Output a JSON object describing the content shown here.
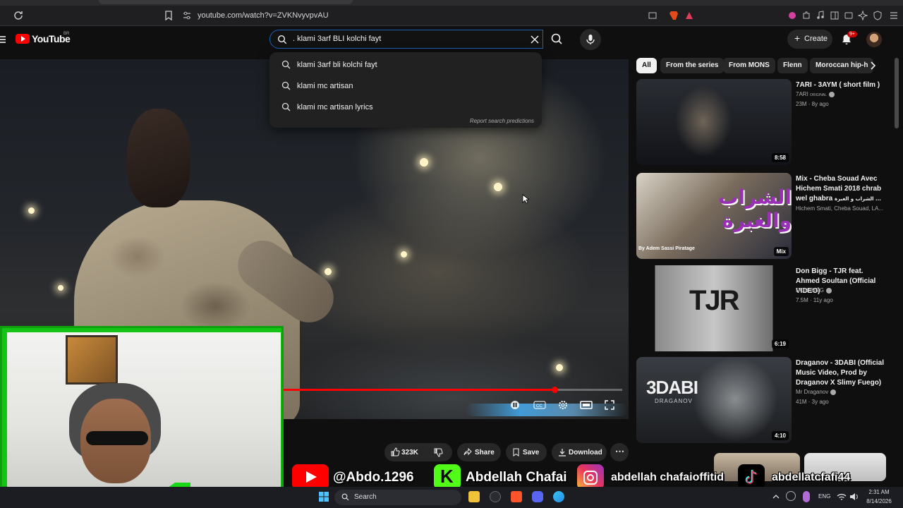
{
  "browser": {
    "url": "youtube.com/watch?v=ZVKNvyvpvAU"
  },
  "header": {
    "logo_text": "YouTube",
    "country_code": "BR",
    "search_value": ". klami 3arf BLI kolchi fayt",
    "create_label": "Create",
    "notif_badge": "9+"
  },
  "suggestions": {
    "items": [
      {
        "label": "klami 3arf bli kolchi fayt"
      },
      {
        "label": "klami mc artisan"
      },
      {
        "label": "klami mc artisan lyrics"
      }
    ],
    "report_label": "Report search predictions"
  },
  "player": {
    "progress_fraction": 0.8
  },
  "chips": [
    "All",
    "From the series",
    "From MONS",
    "Flenn",
    "Moroccan hip-h"
  ],
  "recommendations": [
    {
      "title": "7ARI - 3AYM ( short film )",
      "channel": "7ARI",
      "channel_badge": "ORIGINAL",
      "meta": "23M · 8y ago",
      "duration": "8:58"
    },
    {
      "title": "Mix - Cheba Souad Avec Hichem Smati 2018 chrab wel ghabra",
      "title_suffix": "الشراب و الغبرة ...",
      "channel": "Hichem Smati, Cheba Souad, LA...",
      "meta": "",
      "duration": "Mix",
      "thumb_overlay": "الشراب والغبرة",
      "thumb_credit": "By Adem Sassi Piratage"
    },
    {
      "title": "Don Bigg - TJR feat. Ahmed Soultan (Official VIDEO)",
      "channel": "DON BIGG",
      "meta": "7.5M · 11y ago",
      "duration": "6:19",
      "thumb_overlay": "TJR"
    },
    {
      "title": "Draganov - 3DABI (Official Music Video, Prod by Draganov X Slimy Fuego)",
      "channel": "Mr Draganov",
      "meta": "41M · 3y ago",
      "duration": "4:10",
      "thumb_overlay": "3DABI",
      "thumb_sub": "DRAGANOV"
    }
  ],
  "actions": {
    "likes": "323K",
    "share": "Share",
    "save": "Save",
    "download": "Download"
  },
  "social": {
    "youtube_handle": "@Abdo.1296",
    "kick_name": "Abdellah Chafai",
    "instagram_handle": "abdellah chafaioffitid",
    "tiktok_handle": "abdellatcfafi44"
  },
  "taskbar": {
    "search_label": "Search",
    "lang": "ENG",
    "time": "2:31 AM",
    "date": "8/14/2026"
  },
  "colors": {
    "brand_red": "#ff0000",
    "cam_border_green": "#16c416",
    "focus_blue": "#1c62b9"
  }
}
